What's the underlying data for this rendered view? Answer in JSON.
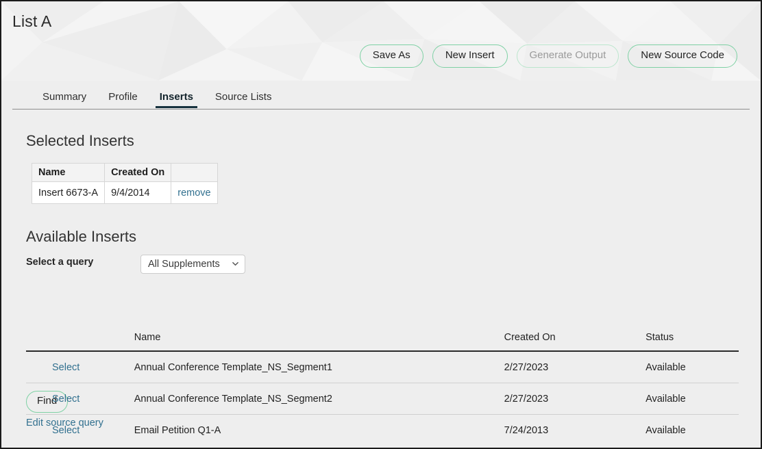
{
  "header": {
    "title": "List A",
    "buttons": [
      {
        "label": "Save As",
        "disabled": false
      },
      {
        "label": "New Insert",
        "disabled": false
      },
      {
        "label": "Generate Output",
        "disabled": true
      },
      {
        "label": "New Source Code",
        "disabled": false
      }
    ]
  },
  "tabs": [
    {
      "label": "Summary",
      "active": false
    },
    {
      "label": "Profile",
      "active": false
    },
    {
      "label": "Inserts",
      "active": true
    },
    {
      "label": "Source Lists",
      "active": false
    }
  ],
  "selected_inserts": {
    "title": "Selected Inserts",
    "columns": [
      "Name",
      "Created On"
    ],
    "rows": [
      {
        "name": "Insert 6673-A",
        "created_on": "9/4/2014",
        "action": "remove"
      }
    ]
  },
  "available_inserts": {
    "title": "Available Inserts",
    "query_label": "Select a query",
    "query_value": "All Supplements",
    "query_options": [
      "All Supplements"
    ],
    "find_label": "Find",
    "edit_link": "Edit source query",
    "columns": [
      "",
      "Name",
      "Created On",
      "Status"
    ],
    "rows": [
      {
        "action": "Select",
        "name": "Annual Conference Template_NS_Segment1",
        "created_on": "2/27/2023",
        "status": "Available"
      },
      {
        "action": "Select",
        "name": "Annual Conference Template_NS_Segment2",
        "created_on": "2/27/2023",
        "status": "Available"
      },
      {
        "action": "Select",
        "name": "Email Petition Q1-A",
        "created_on": "7/24/2013",
        "status": "Available"
      }
    ]
  },
  "colors": {
    "accent_green": "#7ed1a4",
    "link_blue": "#31708f",
    "active_tab_underline": "#16313d",
    "page_background": "#eeeeee"
  }
}
